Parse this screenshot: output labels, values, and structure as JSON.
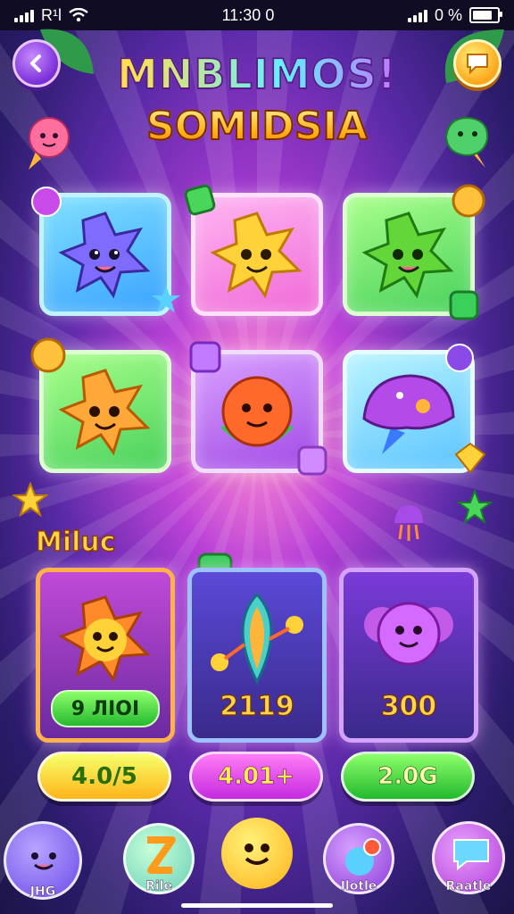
{
  "status_bar": {
    "carrier": "R¹l",
    "time": "11:30 0",
    "battery_text": "0 %"
  },
  "header": {
    "title_line1": "MNBLIMOS!",
    "title_line2": "SOMIDSIA"
  },
  "board": {
    "tiles": [
      {
        "color": "blue",
        "creature": "purple-star-blob"
      },
      {
        "color": "pink",
        "creature": "yellow-star-blob"
      },
      {
        "color": "green",
        "creature": "green-star-blob"
      },
      {
        "color": "green",
        "creature": "orange-star-blob"
      },
      {
        "color": "purple",
        "creature": "orange-ball-blob"
      },
      {
        "color": "cyan",
        "creature": "purple-jelly"
      }
    ]
  },
  "shop": {
    "section_title": "Miluc",
    "cards": [
      {
        "creature": "orange-star-blob",
        "pill_label": "9 ЛIOI"
      },
      {
        "creature": "rainbow-rocket",
        "price": "2119"
      },
      {
        "creature": "purple-cloud-blob",
        "price": "300"
      }
    ],
    "buy_buttons": [
      "4.0/5",
      "4.01+",
      "2.0G"
    ]
  },
  "bottom_nav": [
    {
      "label": "JHG",
      "icon": "blue-blob-icon"
    },
    {
      "label": "Rile",
      "icon": "z-badge-icon"
    },
    {
      "label": "",
      "icon": "smiley-chat-icon"
    },
    {
      "label": "Ilotle",
      "icon": "bubble-alert-icon"
    },
    {
      "label": "Raatle",
      "icon": "chat-bubble-icon"
    }
  ],
  "colors": {
    "accent_gold": "#ffd64a",
    "bg_purple": "#5a2aa8",
    "pink": "#f06ad8"
  }
}
